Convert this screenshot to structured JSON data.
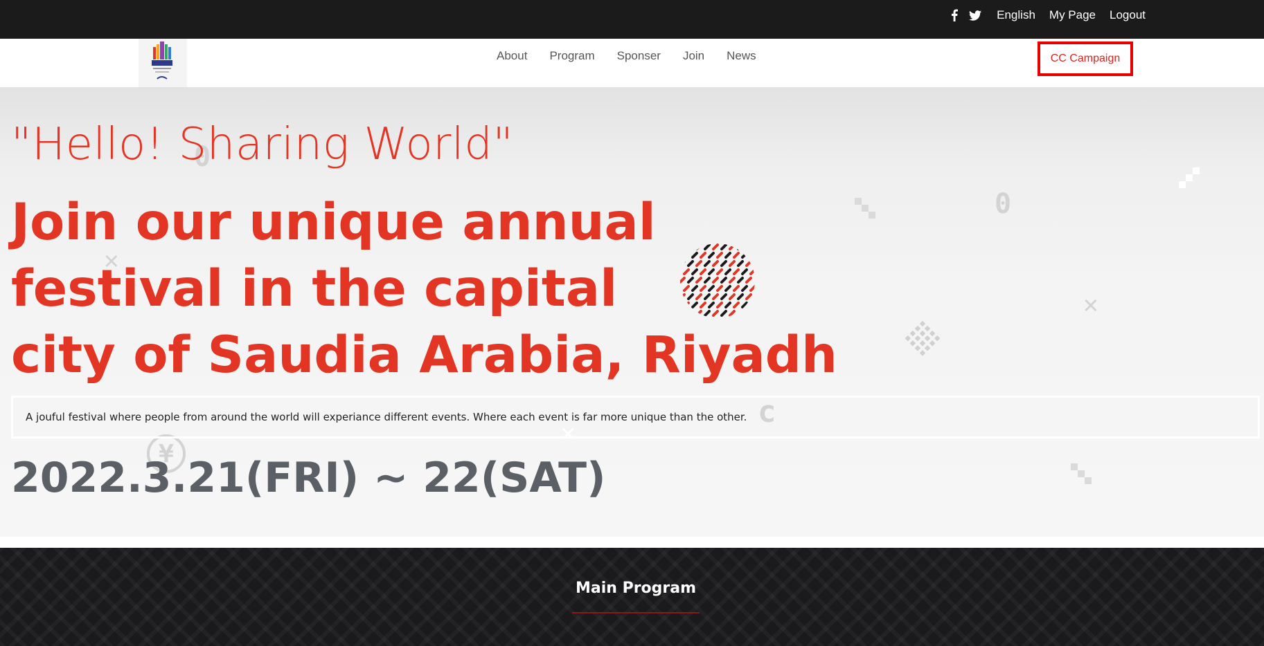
{
  "topbar": {
    "social": [
      "facebook-icon",
      "twitter-icon"
    ],
    "language": "English",
    "my_page": "My Page",
    "logout": "Logout"
  },
  "nav": {
    "logo_icon": "riyadh-logo-icon",
    "links": [
      "About",
      "Program",
      "Sponser",
      "Join",
      "News"
    ],
    "cta": "CC Campaign"
  },
  "hero": {
    "tagline": "\"Hello! Sharing World\"",
    "headline_lines": [
      "Join our unique annual",
      "festival in the capital",
      "city of Saudia Arabia, Riyadh"
    ],
    "description": "A jouful festival where people from around the world will experiance different events. Where each event is far more unique than the other.",
    "date": "2022.3.21(FRI) ~ 22(SAT)"
  },
  "program": {
    "title": "Main Program"
  },
  "colors": {
    "accent_red": "#e33524",
    "cta_border": "#e60000",
    "dark_bg": "#1b1b1b",
    "date_gray": "#5b5f66"
  }
}
